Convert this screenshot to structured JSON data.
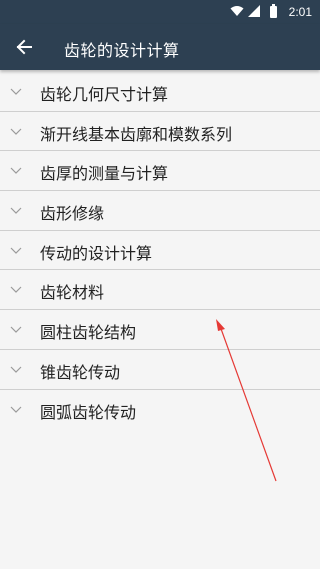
{
  "status_bar": {
    "time": "2:01",
    "icons": [
      "wifi-icon",
      "signal-icon",
      "battery-icon"
    ]
  },
  "app_bar": {
    "back_icon": "arrow-left-icon",
    "title": "齿轮的设计计算",
    "background_color": "#2d4052"
  },
  "list": {
    "items": [
      {
        "label": "齿轮几何尺寸计算",
        "icon": "chevron-down-icon"
      },
      {
        "label": "渐开线基本齿廓和模数系列",
        "icon": "chevron-down-icon"
      },
      {
        "label": "齿厚的测量与计算",
        "icon": "chevron-down-icon"
      },
      {
        "label": "齿形修缘",
        "icon": "chevron-down-icon"
      },
      {
        "label": "传动的设计计算",
        "icon": "chevron-down-icon"
      },
      {
        "label": "齿轮材料",
        "icon": "chevron-down-icon"
      },
      {
        "label": "圆柱齿轮结构",
        "icon": "chevron-down-icon"
      },
      {
        "label": "锥齿轮传动",
        "icon": "chevron-down-icon"
      },
      {
        "label": "圆弧齿轮传动",
        "icon": "chevron-down-icon"
      }
    ]
  },
  "annotation": {
    "arrow_color": "#e53935"
  }
}
